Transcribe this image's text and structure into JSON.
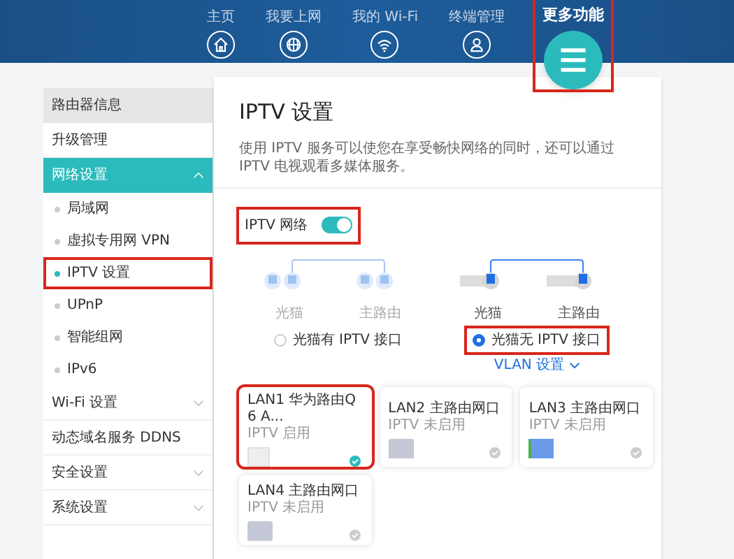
{
  "nav": [
    {
      "label": "主页",
      "selected": false,
      "highlighted": false
    },
    {
      "label": "我要上网",
      "selected": false,
      "highlighted": false
    },
    {
      "label": "我的 Wi-Fi",
      "selected": false,
      "highlighted": false
    },
    {
      "label": "终端管理",
      "selected": false,
      "highlighted": false
    },
    {
      "label": "更多功能",
      "selected": true,
      "highlighted": true
    }
  ],
  "sidebar": {
    "items": [
      {
        "label": "路由器信息",
        "kind": "header",
        "selected": false
      },
      {
        "label": "升级管理",
        "kind": "plain",
        "selected": false
      },
      {
        "label": "网络设置",
        "kind": "group",
        "expanded": true,
        "selected": true,
        "children": [
          {
            "label": "局域网",
            "selected": false
          },
          {
            "label": "虚拟专用网 VPN",
            "selected": false
          },
          {
            "label": "IPTV 设置",
            "selected": true,
            "highlighted": true
          },
          {
            "label": "UPnP",
            "selected": false
          },
          {
            "label": "智能组网",
            "selected": false
          },
          {
            "label": "IPv6",
            "selected": false
          }
        ]
      },
      {
        "label": "Wi-Fi 设置",
        "kind": "group",
        "expanded": false,
        "selected": false
      },
      {
        "label": "动态域名服务 DDNS",
        "kind": "plain",
        "selected": false
      },
      {
        "label": "安全设置",
        "kind": "group",
        "expanded": false,
        "selected": false
      },
      {
        "label": "系统设置",
        "kind": "group",
        "expanded": false,
        "selected": false
      }
    ]
  },
  "content": {
    "title": "IPTV 设置",
    "description": "使用 IPTV 服务可以使您在享受畅快网络的同时，还可以通过 IPTV 电视观看多媒体服务。",
    "toggle": {
      "label": "IPTV 网络",
      "on": true,
      "highlighted": true
    },
    "modes": [
      {
        "device_a": "光猫",
        "device_b": "主路由",
        "label": "光猫有 IPTV 接口",
        "selected": false,
        "highlighted": false
      },
      {
        "device_a": "光猫",
        "device_b": "主路由",
        "label": "光猫无 IPTV 接口",
        "selected": true,
        "highlighted": true
      }
    ],
    "vlan_link": "VLAN 设置",
    "ports": [
      {
        "name": "LAN1 华为路由Q6 A...",
        "status": "IPTV 启用",
        "kind": "device",
        "selected": true,
        "highlighted": true
      },
      {
        "name": "LAN2 主路由网口",
        "status": "IPTV 未启用",
        "kind": "port",
        "selected": false,
        "highlighted": false
      },
      {
        "name": "LAN3 主路由网口",
        "status": "IPTV 未启用",
        "kind": "port-linked",
        "selected": false,
        "highlighted": false
      },
      {
        "name": "LAN4 主路由网口",
        "status": "IPTV 未启用",
        "kind": "port",
        "selected": false,
        "highlighted": false
      }
    ]
  }
}
